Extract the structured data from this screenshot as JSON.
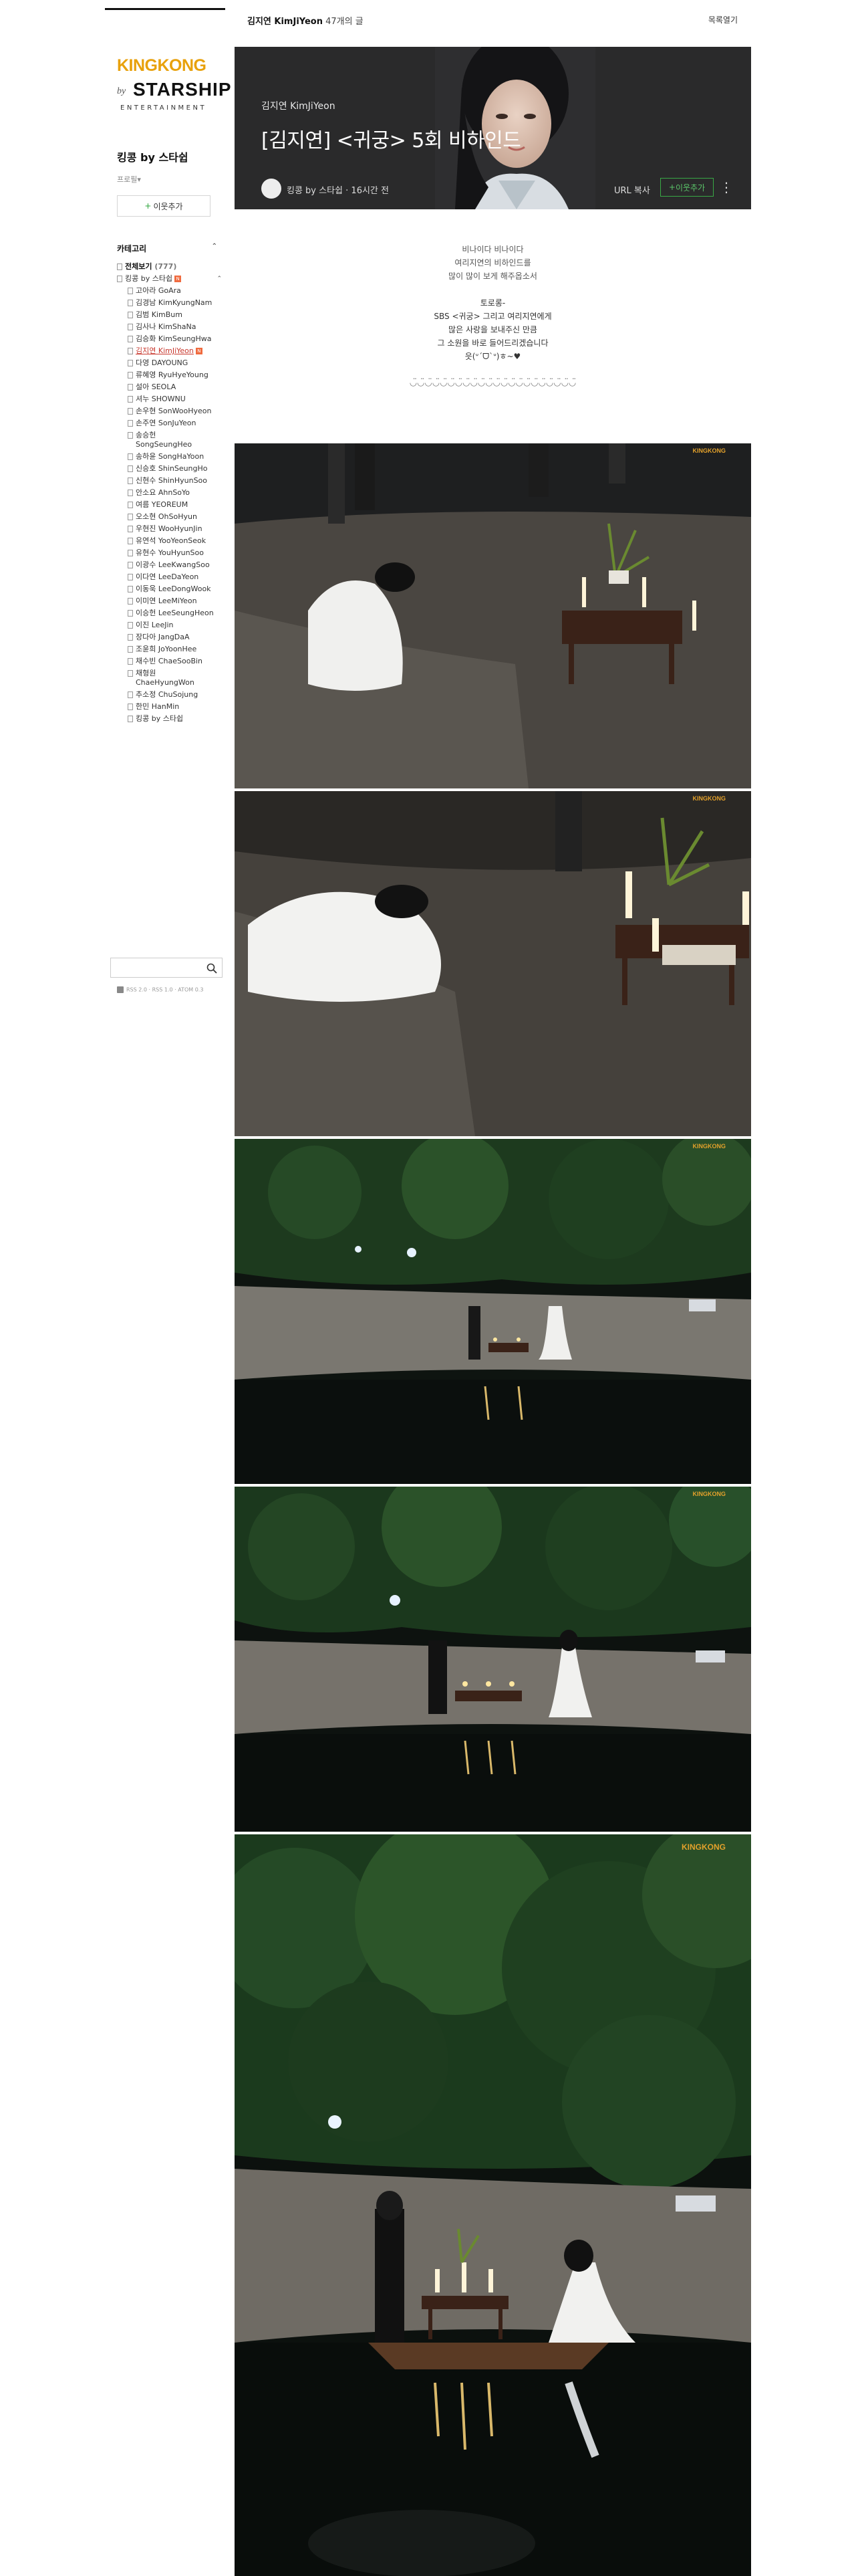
{
  "header": {
    "board_title": "김지연 KimJiYeon",
    "post_count": "47개의 글",
    "list_link": "목록열기"
  },
  "sidebar": {
    "logo": {
      "top": "KINGKONG",
      "by": "by",
      "star": "STARSHIP",
      "ent": "ENTERTAINMENT"
    },
    "cafe_name": "킹콩 by 스타쉽",
    "profile_link": "프로필▾",
    "neighbor_button": "이웃추가",
    "category_header": "카테고리",
    "categories": [
      {
        "label": "전체보기",
        "count": "(777)",
        "level": 0,
        "bold": true
      },
      {
        "label": "킹콩 by 스타쉽",
        "level": 0,
        "new": true,
        "caret": true
      },
      {
        "label": "고아라 GoAra",
        "level": 1
      },
      {
        "label": "김경남 KimKyungNam",
        "level": 1
      },
      {
        "label": "김범 KimBum",
        "level": 1
      },
      {
        "label": "김사나 KimShaNa",
        "level": 1
      },
      {
        "label": "김승화 KimSeungHwa",
        "level": 1
      },
      {
        "label": "김지연 KimJiYeon",
        "level": 1,
        "active": true,
        "new": true
      },
      {
        "label": "다영 DAYOUNG",
        "level": 1
      },
      {
        "label": "류혜영 RyuHyeYoung",
        "level": 1
      },
      {
        "label": "설아 SEOLA",
        "level": 1
      },
      {
        "label": "셔누 SHOWNU",
        "level": 1
      },
      {
        "label": "손우현 SonWooHyeon",
        "level": 1
      },
      {
        "label": "손주연 SonJuYeon",
        "level": 1
      },
      {
        "label": "송승헌 SongSeungHeo",
        "level": 1
      },
      {
        "label": "송하윤 SongHaYoon",
        "level": 1
      },
      {
        "label": "신승호 ShinSeungHo",
        "level": 1
      },
      {
        "label": "신현수 ShinHyunSoo",
        "level": 1
      },
      {
        "label": "안소요 AhnSoYo",
        "level": 1
      },
      {
        "label": "여름 YEOREUM",
        "level": 1
      },
      {
        "label": "오소현 OhSoHyun",
        "level": 1
      },
      {
        "label": "우현진 WooHyunJin",
        "level": 1
      },
      {
        "label": "유연석 YooYeonSeok",
        "level": 1
      },
      {
        "label": "유현수 YouHyunSoo",
        "level": 1
      },
      {
        "label": "이광수 LeeKwangSoo",
        "level": 1
      },
      {
        "label": "이다연 LeeDaYeon",
        "level": 1
      },
      {
        "label": "이동욱 LeeDongWook",
        "level": 1
      },
      {
        "label": "이미연 LeeMiYeon",
        "level": 1
      },
      {
        "label": "이승헌 LeeSeungHeon",
        "level": 1
      },
      {
        "label": "이진 LeeJin",
        "level": 1
      },
      {
        "label": "장다아 JangDaA",
        "level": 1
      },
      {
        "label": "조윤희 JoYoonHee",
        "level": 1
      },
      {
        "label": "채수빈 ChaeSooBin",
        "level": 1
      },
      {
        "label": "채형원 ChaeHyungWon",
        "level": 1
      },
      {
        "label": "추소정 ChuSojung",
        "level": 1
      },
      {
        "label": "한민 HanMin",
        "level": 1
      },
      {
        "label": "킹콩 by 스타쉽",
        "level": 1
      }
    ],
    "search_placeholder": "",
    "footer": "RSS 2.0 · RSS 1.0 · ATOM 0.3"
  },
  "post": {
    "category": "김지연 KimJiYeon",
    "title": "[김지연] <귀궁> 5회 비하인드",
    "author": "킹콩 by 스타쉽",
    "time": "16시간 전",
    "url_copy": "URL 복사",
    "neighbor_button": "이웃추가",
    "more_icon": "⋮",
    "body_lines": [
      "비나이다 비나이다",
      "여리지연의 비하인드를",
      "많이 많이 보게 해주옵소서",
      "",
      "토로롱-",
      "SBS <귀궁> 그리고 여리지연에게",
      "많은 사랑을 보내주신 만큼",
      "그 소원을 바로 들어드리겠습니다",
      "읏(ᐡˊᗜˋᐡ)ㅎ~♥",
      "",
      "◡̈◡̈◡̈◡̈◡̈◡̈◡̈◡̈◡̈◡̈◡̈◡̈◡̈◡̈◡̈◡̈◡̈◡̈◡̈◡̈◡̈◡̈"
    ],
    "watermark": "KINGKONG"
  }
}
